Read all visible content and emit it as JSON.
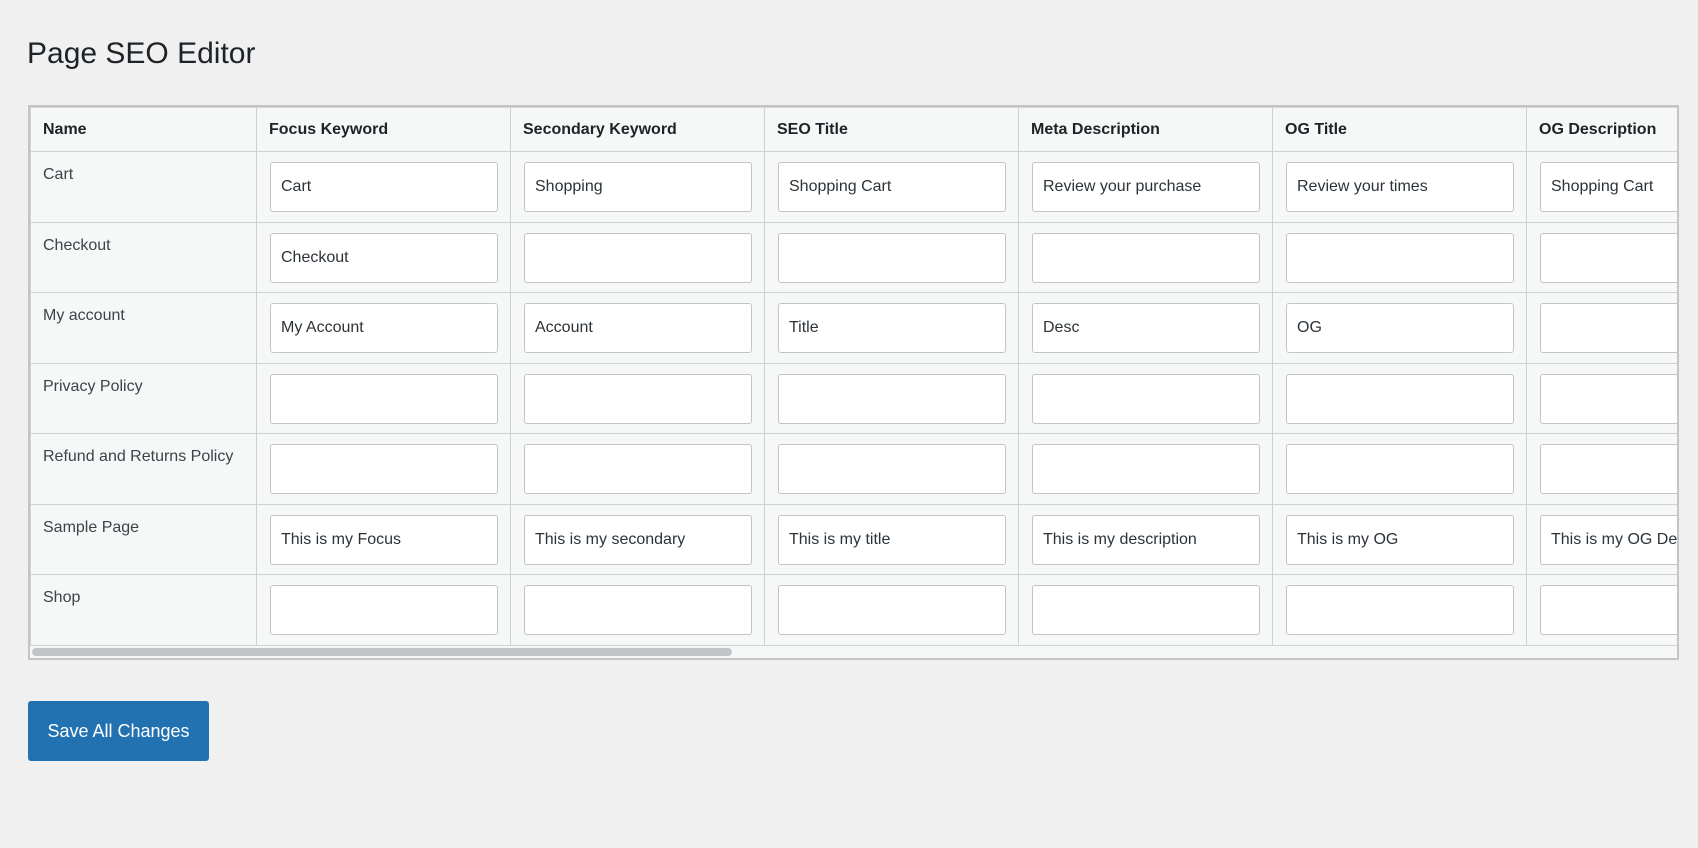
{
  "page": {
    "title": "Page SEO Editor"
  },
  "table": {
    "columns": [
      "Name",
      "Focus Keyword",
      "Secondary Keyword",
      "SEO Title",
      "Meta Description",
      "OG Title",
      "OG Description"
    ],
    "rows": [
      {
        "name": "Cart",
        "values": [
          "Cart",
          "Shopping",
          "Shopping Cart",
          "Review your purchase",
          "Review your times",
          "Shopping Cart"
        ]
      },
      {
        "name": "Checkout",
        "values": [
          "Checkout",
          "",
          "",
          "",
          "",
          ""
        ]
      },
      {
        "name": "My account",
        "values": [
          "My Account",
          "Account",
          "Title",
          "Desc",
          "OG",
          ""
        ]
      },
      {
        "name": "Privacy Policy",
        "values": [
          "",
          "",
          "",
          "",
          "",
          ""
        ]
      },
      {
        "name": "Refund and Returns Policy",
        "values": [
          "",
          "",
          "",
          "",
          "",
          ""
        ]
      },
      {
        "name": "Sample Page",
        "values": [
          "This is my Focus",
          "This is my secondary",
          "This is my title",
          "This is my description",
          "This is my OG",
          "This is my OG Description"
        ]
      },
      {
        "name": "Shop",
        "values": [
          "",
          "",
          "",
          "",
          "",
          ""
        ]
      }
    ]
  },
  "actions": {
    "save_label": "Save All Changes"
  },
  "colors": {
    "background": "#f0f0f1",
    "button": "#2271b1",
    "border": "#c3c4c7"
  }
}
